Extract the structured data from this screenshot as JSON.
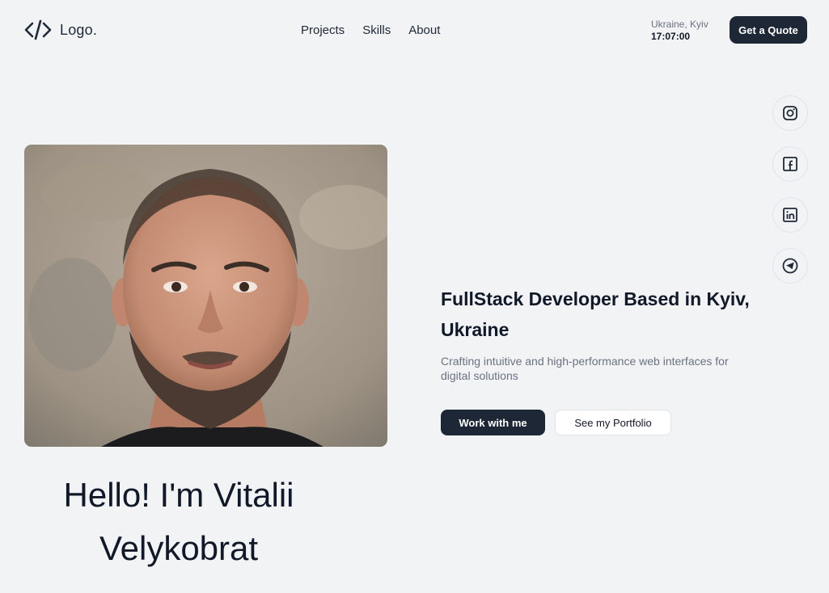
{
  "header": {
    "logo_text": "Logo.",
    "logo_icon": "code-brackets-icon",
    "nav": [
      {
        "label": "Projects"
      },
      {
        "label": "Skills"
      },
      {
        "label": "About"
      }
    ],
    "location": {
      "city": "Ukraine, Kyiv",
      "time": "17:07:00"
    },
    "quote_button": "Get a Quote"
  },
  "socials": [
    {
      "icon": "instagram-icon"
    },
    {
      "icon": "facebook-icon"
    },
    {
      "icon": "linkedin-icon"
    },
    {
      "icon": "telegram-icon"
    }
  ],
  "hero": {
    "photo": "portrait-photo",
    "headline": "FullStack Developer Based in Kyiv, Ukraine",
    "subtitle": "Crafting intuitive and high-performance web interfaces for digital solutions",
    "primary_cta": "Work with me",
    "secondary_cta": "See my Portfolio",
    "greeting": "Hello! I'm Vitalii Velykobrat"
  },
  "colors": {
    "background": "#f1f3f5",
    "accent_dark": "#1e2736",
    "text_primary": "#111827",
    "text_muted": "#6b7280"
  }
}
